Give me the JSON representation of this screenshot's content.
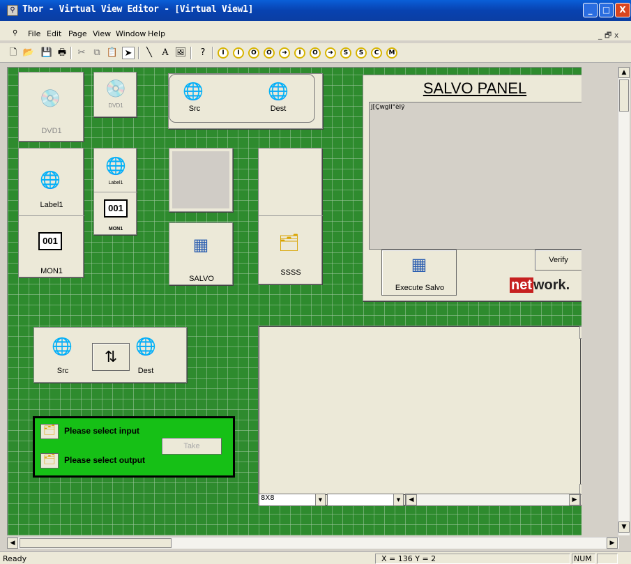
{
  "window": {
    "title": "Thor - Virtual View Editor - [Virtual View1]",
    "min": "_",
    "max": "□",
    "close": "X"
  },
  "menu": {
    "items": [
      "File",
      "Edit",
      "Page",
      "View",
      "Window",
      "Help"
    ],
    "restore": "_ 🗗 x"
  },
  "toolbar": {
    "text_tool": "A",
    "circle_tools": [
      "I",
      "I",
      "O",
      "O",
      "➜",
      "I",
      "O",
      "➜",
      "S",
      "S",
      "C",
      "M"
    ]
  },
  "canvas": {
    "dvd_large": {
      "label": "DVD1"
    },
    "dvd_small": {
      "label": "DVD1"
    },
    "src_dest_top": {
      "src": "Src",
      "dest": "Dest"
    },
    "label_panel": {
      "label": "Label1",
      "mon_value": "001",
      "mon_label": "MON1"
    },
    "small_label": {
      "label": "Label1",
      "mon_value": "001",
      "mon_label": "MON1"
    },
    "salvo_button": {
      "label": "SALVO"
    },
    "ssss_panel": {
      "label": "SSSS"
    },
    "salvo_panel": {
      "title": "SALVO PANEL",
      "list_text": "J[ÇwgII\"èIÿ",
      "execute": "Execute Salvo",
      "verify": "Verify",
      "logo_net": "net",
      "logo_work": "work."
    },
    "src_dest_bottom": {
      "src": "Src",
      "dest": "Dest",
      "swap": "⇅"
    },
    "take_panel": {
      "input": "Please select input",
      "output": "Please select output",
      "take": "Take"
    },
    "matrix": {
      "size": "8X8"
    }
  },
  "status": {
    "ready": "Ready",
    "coords": "X = 136  Y = 2",
    "num": "NUM"
  }
}
